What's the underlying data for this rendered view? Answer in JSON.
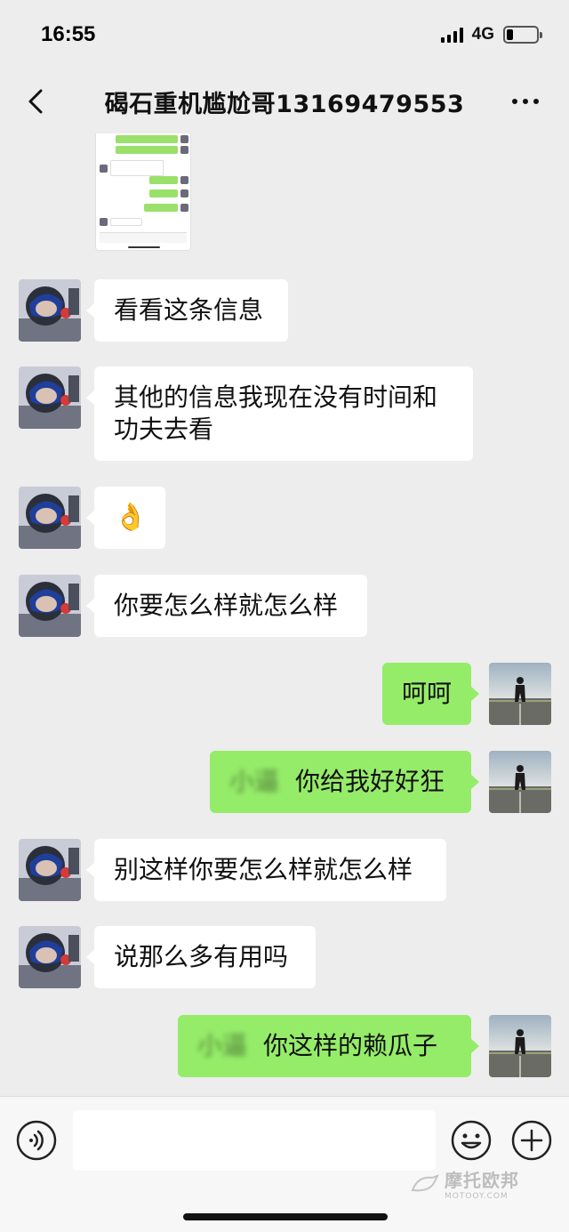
{
  "status_bar": {
    "time": "16:55",
    "network": "4G"
  },
  "header": {
    "title": "碣石重机尴尬哥13169479553"
  },
  "messages": [
    {
      "from": "contact",
      "text": "看看这条信息"
    },
    {
      "from": "contact",
      "text": "其他的信息我现在没有时间和功夫去看"
    },
    {
      "from": "contact",
      "text": "👌"
    },
    {
      "from": "contact",
      "text": "你要怎么样就怎么样"
    },
    {
      "from": "me",
      "text": "呵呵"
    },
    {
      "from": "me",
      "blurred": "小逼",
      "text": "你给我好好狂"
    },
    {
      "from": "contact",
      "text": "别这样你要怎么样就怎么样"
    },
    {
      "from": "contact",
      "text": "说那么多有用吗"
    },
    {
      "from": "me",
      "blurred": "小逼",
      "text": "你这样的赖瓜子"
    }
  ],
  "input_bar": {
    "placeholder": ""
  },
  "watermark": {
    "main": "摩托欧邦",
    "sub": "MOTOOY.COM"
  },
  "colors": {
    "background": "#ededed",
    "my_bubble": "#95ec69",
    "their_bubble": "#ffffff"
  },
  "icons": [
    "back-chevron-icon",
    "more-icon",
    "voice-icon",
    "emoji-icon",
    "plus-icon"
  ]
}
